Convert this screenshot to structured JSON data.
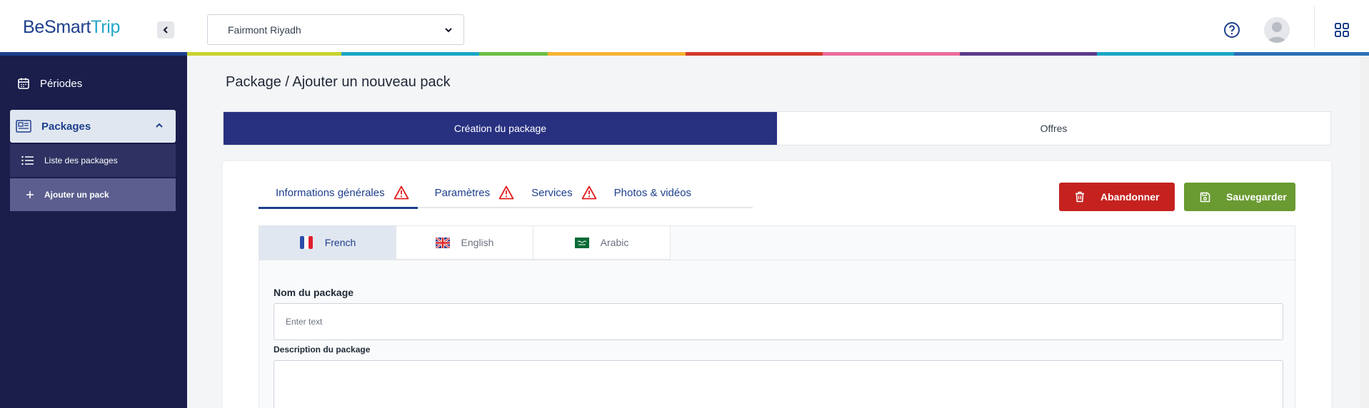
{
  "app": {
    "logo_part1": "BeSmart",
    "logo_part2": "Trip",
    "hotel_selected": "Fairmont Riyadh"
  },
  "colors": {
    "brand": "#1d3f8c",
    "sidebar_bg": "#1b1d4b",
    "step_active": "#283180",
    "abandon": "#c5221f",
    "save": "#6a9a32",
    "warning": "#e11d1d",
    "stripe": [
      "#1d3f8c",
      "#c7d22e",
      "#19a7c6",
      "#6abf45",
      "#f5b232",
      "#d23a2b",
      "#ea6d9b",
      "#5c3b8e",
      "#1aa7c5",
      "#2b6fb8"
    ]
  },
  "sidebar": {
    "periodes": "Périodes",
    "packages": "Packages",
    "sub_items": [
      {
        "label": "Liste des packages",
        "icon": "list-icon"
      },
      {
        "label": "Ajouter un pack",
        "icon": "plus-icon"
      }
    ]
  },
  "main": {
    "title": "Package / Ajouter un nouveau pack",
    "steps": [
      "Création du package",
      "Offres"
    ],
    "tabs": [
      {
        "label": "Informations générales",
        "warning": true
      },
      {
        "label": "Paramètres",
        "warning": true
      },
      {
        "label": "Services",
        "warning": true
      },
      {
        "label": "Photos & vidéos",
        "warning": false
      }
    ],
    "buttons": {
      "abandon": "Abandonner",
      "save": "Sauvegarder"
    },
    "languages": [
      "French",
      "English",
      "Arabic"
    ],
    "form": {
      "name_label": "Nom du package",
      "name_placeholder": "Enter text",
      "desc_label": "Description du package"
    }
  }
}
